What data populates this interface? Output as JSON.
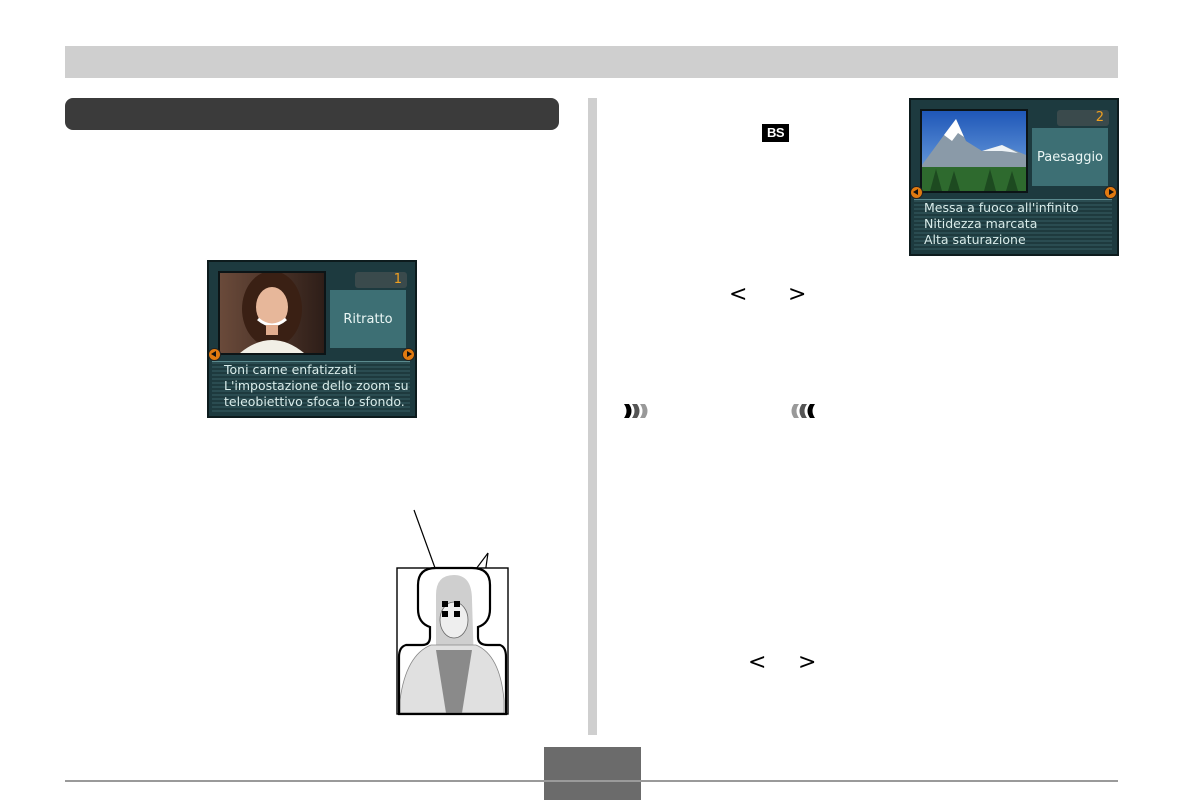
{
  "lcd_portrait": {
    "number": "1",
    "mode": "Ritratto",
    "desc": [
      "Toni carne enfatizzati",
      "L'impostazione dello zoom su",
      "teleobiettivo sfoca lo sfondo."
    ]
  },
  "lcd_landscape": {
    "number": "2",
    "mode": "Paesaggio",
    "desc": [
      "Messa a fuoco all'infinito",
      "Nitidezza marcata",
      "Alta saturazione"
    ]
  },
  "icons": {
    "best_shot": "BS",
    "chevron_left": "<",
    "chevron_right": ">"
  },
  "colors": {
    "lcd_bg": "#1d3a3f",
    "lcd_panel": "#3d6f74",
    "lcd_number": "#f0a020",
    "lcd_arrow": "#e07a10"
  }
}
